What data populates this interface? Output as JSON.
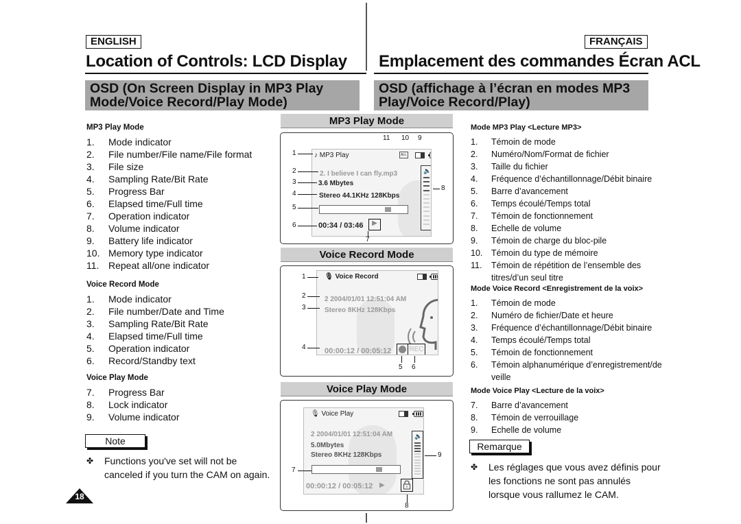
{
  "header": {
    "lang_en": "ENGLISH",
    "lang_fr": "FRANÇAIS",
    "title_en": "Location of Controls: LCD Display",
    "title_fr": "Emplacement des commandes Écran ACL",
    "section_en": "OSD (On Screen Display in MP3 Play Mode/Voice Record/Play Mode)",
    "section_fr": "OSD (affichage à l’écran en modes MP3 Play/Voice Record/Play)"
  },
  "english": {
    "mp3": {
      "heading": "MP3 Play Mode",
      "items": [
        {
          "n": "1.",
          "t": "Mode indicator"
        },
        {
          "n": "2.",
          "t": "File number/File name/File format"
        },
        {
          "n": "3.",
          "t": "File size"
        },
        {
          "n": "4.",
          "t": "Sampling Rate/Bit Rate"
        },
        {
          "n": "5.",
          "t": "Progress Bar"
        },
        {
          "n": "6.",
          "t": "Elapsed time/Full time"
        },
        {
          "n": "7.",
          "t": "Operation indicator"
        },
        {
          "n": "8.",
          "t": "Volume indicator"
        },
        {
          "n": "9.",
          "t": "Battery life indicator"
        },
        {
          "n": "10.",
          "t": "Memory type indicator"
        },
        {
          "n": "11.",
          "t": "Repeat all/one indicator"
        }
      ]
    },
    "voice_record": {
      "heading": "Voice Record Mode",
      "items": [
        {
          "n": "1.",
          "t": "Mode indicator"
        },
        {
          "n": "2.",
          "t": "File number/Date and Time"
        },
        {
          "n": "3.",
          "t": "Sampling Rate/Bit Rate"
        },
        {
          "n": "4.",
          "t": "Elapsed time/Full time"
        },
        {
          "n": "5.",
          "t": "Operation indicator"
        },
        {
          "n": "6.",
          "t": "Record/Standby text"
        }
      ]
    },
    "voice_play": {
      "heading": "Voice Play Mode",
      "items": [
        {
          "n": "7.",
          "t": "Progress Bar"
        },
        {
          "n": "8.",
          "t": "Lock indicator"
        },
        {
          "n": "9.",
          "t": "Volume indicator"
        }
      ]
    },
    "note_label": "Note",
    "note_text": "Functions you've set will not be canceled if you turn the CAM on again."
  },
  "french": {
    "mp3": {
      "heading": "Mode MP3 Play <Lecture MP3>",
      "items": [
        {
          "n": "1.",
          "t": "Témoin de mode"
        },
        {
          "n": "2.",
          "t": "Numéro/Nom/Format de fichier"
        },
        {
          "n": "3.",
          "t": "Taille du fichier"
        },
        {
          "n": "4.",
          "t": "Fréquence d’échantillonnage/Débit binaire"
        },
        {
          "n": "5.",
          "t": "Barre d’avancement"
        },
        {
          "n": "6.",
          "t": "Temps écoulé/Temps total"
        },
        {
          "n": "7.",
          "t": "Témoin de fonctionnement"
        },
        {
          "n": "8.",
          "t": "Echelle de volume"
        },
        {
          "n": "9.",
          "t": "Témoin de charge du bloc-pile"
        },
        {
          "n": "10.",
          "t": "Témoin du type de mémoire"
        },
        {
          "n": "11.",
          "t": "Témoin de répétition de l’ensemble des titres/d’un seul titre"
        }
      ]
    },
    "voice_record": {
      "heading": "Mode Voice Record <Enregistrement de la voix>",
      "items": [
        {
          "n": "1.",
          "t": "Témoin de mode"
        },
        {
          "n": "2.",
          "t": "Numéro de fichier/Date et heure"
        },
        {
          "n": "3.",
          "t": "Fréquence d’échantillonnage/Débit binaire"
        },
        {
          "n": "4.",
          "t": "Temps écoulé/Temps total"
        },
        {
          "n": "5.",
          "t": "Témoin de fonctionnement"
        },
        {
          "n": "6.",
          "t": "Témoin alphanumérique d’enregistrement/de veille"
        }
      ]
    },
    "voice_play": {
      "heading": "Mode Voice Play <Lecture de la voix>",
      "items": [
        {
          "n": "7.",
          "t": "Barre d’avancement"
        },
        {
          "n": "8.",
          "t": "Témoin de verrouillage"
        },
        {
          "n": "9.",
          "t": "Echelle de volume"
        }
      ]
    },
    "note_label": "Remarque",
    "note_text": "Les réglages que vous avez définis pour les fonctions ne sont pas annulés lorsque vous rallumez le CAM."
  },
  "bullet_glyph": "✤",
  "page_number": "18",
  "diagrams": {
    "mp3": {
      "title": "MP3 Play Mode",
      "mode_label": "MP3 Play",
      "mode_icon": "music-note-icon",
      "file": "2.  I believe I can fly.mp3",
      "size": "3.6 Mbytes",
      "rate": "Stereo 44.1KHz 128Kbps",
      "time": "00:34 / 03:46",
      "repeat_label": "ALL",
      "progress": 0.8,
      "volume_level": 4,
      "volume_max": 12,
      "callouts": {
        "c1": "1",
        "c2": "2",
        "c3": "3",
        "c4": "4",
        "c5": "5",
        "c6": "6",
        "c7": "7",
        "c8": "8",
        "c9": "9",
        "c10": "10",
        "c11": "11"
      }
    },
    "voice_record": {
      "title": "Voice Record Mode",
      "mode_label": "Voice Record",
      "mode_icon": "microphone-icon",
      "file": "2  2004/01/01  12:51:04 AM",
      "rate": "Stereo  8KHz  128Kbps",
      "time": "00:00:12 / 00:05:12",
      "status_text": "REC",
      "callouts": {
        "c1": "1",
        "c2": "2",
        "c3": "3",
        "c4": "4",
        "c5": "5",
        "c6": "6"
      }
    },
    "voice_play": {
      "title": "Voice Play Mode",
      "mode_label": "Voice Play",
      "mode_icon": "microphone-icon",
      "file": "2  2004/01/01  12:51:04 AM",
      "size": "5.0Mbytes",
      "rate": "Stereo  8KHz  128Kbps",
      "time": "00:00:12 / 00:05:12",
      "progress": 0.78,
      "volume_level": 4,
      "volume_max": 12,
      "callouts": {
        "c7": "7",
        "c8": "8",
        "c9": "9"
      }
    }
  }
}
